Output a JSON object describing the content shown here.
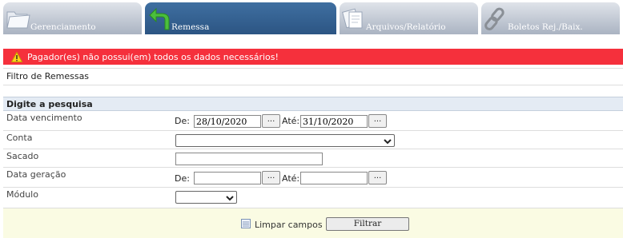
{
  "tabs": [
    {
      "label": "Gerenciamento",
      "icon": "folder-icon"
    },
    {
      "label": "Remessa",
      "icon": "return-arrow-icon"
    },
    {
      "label": "Arquivos/Relatório",
      "icon": "documents-icon"
    },
    {
      "label": "Boletos Rej./Baix.",
      "icon": "chain-link-icon"
    }
  ],
  "alert": {
    "message": "Pagador(es) não possui(em) todos os dados necessários!",
    "color": "#f5303c"
  },
  "filter_title": "Filtro de Remessas",
  "search": {
    "header": "Digite a pesquisa",
    "vencimento": {
      "label": "Data vencimento",
      "de_label": "De:",
      "de_value": "28/10/2020",
      "ate_label": "Até:",
      "ate_value": "31/10/2020",
      "btn": "..."
    },
    "conta": {
      "label": "Conta",
      "value": ""
    },
    "sacado": {
      "label": "Sacado",
      "value": ""
    },
    "geracao": {
      "label": "Data geração",
      "de_label": "De:",
      "de_value": "",
      "ate_label": "Até:",
      "ate_value": "",
      "btn": "..."
    },
    "modulo": {
      "label": "Módulo",
      "value": ""
    }
  },
  "actions": {
    "clear": "Limpar campos",
    "filter": "Filtrar"
  }
}
